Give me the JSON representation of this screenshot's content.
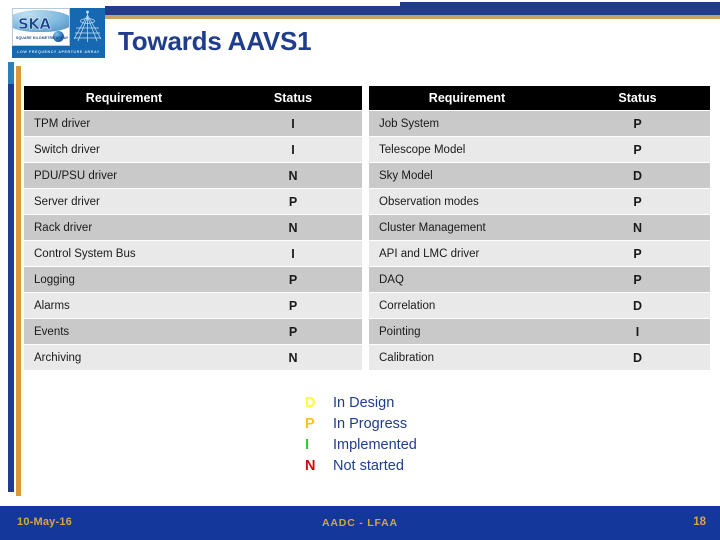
{
  "slide": {
    "title": "Towards AAVS1",
    "logo": {
      "mark": "SKA",
      "tagline": "SQUARE KILOMETRE ARRAY",
      "band": "LOW FREQUENCY APERTURE ARRAY"
    }
  },
  "table_left": {
    "headers": [
      "Requirement",
      "Status"
    ],
    "rows": [
      {
        "requirement": "TPM driver",
        "status": "I"
      },
      {
        "requirement": "Switch driver",
        "status": "I"
      },
      {
        "requirement": "PDU/PSU driver",
        "status": "N"
      },
      {
        "requirement": "Server driver",
        "status": "P"
      },
      {
        "requirement": "Rack driver",
        "status": "N"
      },
      {
        "requirement": "Control System Bus",
        "status": "I"
      },
      {
        "requirement": "Logging",
        "status": "P"
      },
      {
        "requirement": "Alarms",
        "status": "P"
      },
      {
        "requirement": "Events",
        "status": "P"
      },
      {
        "requirement": "Archiving",
        "status": "N"
      }
    ]
  },
  "table_right": {
    "headers": [
      "Requirement",
      "Status"
    ],
    "rows": [
      {
        "requirement": "Job System",
        "status": "P"
      },
      {
        "requirement": "Telescope Model",
        "status": "P"
      },
      {
        "requirement": "Sky Model",
        "status": "D"
      },
      {
        "requirement": "Observation modes",
        "status": "P"
      },
      {
        "requirement": "Cluster Management",
        "status": "N"
      },
      {
        "requirement": "API and LMC driver",
        "status": "P"
      },
      {
        "requirement": "DAQ",
        "status": "P"
      },
      {
        "requirement": "Correlation",
        "status": "D"
      },
      {
        "requirement": "Pointing",
        "status": "I"
      },
      {
        "requirement": "Calibration",
        "status": "D"
      }
    ]
  },
  "legend": {
    "items": [
      {
        "key": "D",
        "label": "In Design",
        "color": "#ffff33"
      },
      {
        "key": "P",
        "label": "In Progress",
        "color": "#ffbf1f"
      },
      {
        "key": "I",
        "label": "Implemented",
        "color": "#33cc33"
      },
      {
        "key": "N",
        "label": "Not started",
        "color": "#cc0c14"
      }
    ]
  },
  "footer": {
    "date": "10-May-16",
    "center": "AADC - LFAA",
    "page": "18"
  },
  "colors": {
    "brand_blue": "#1f3d8c",
    "footer_blue": "#14379b",
    "gold": "#d9a340",
    "header_black": "#000000",
    "row_odd": "#c9c9c9",
    "row_even": "#e9e9e9"
  }
}
